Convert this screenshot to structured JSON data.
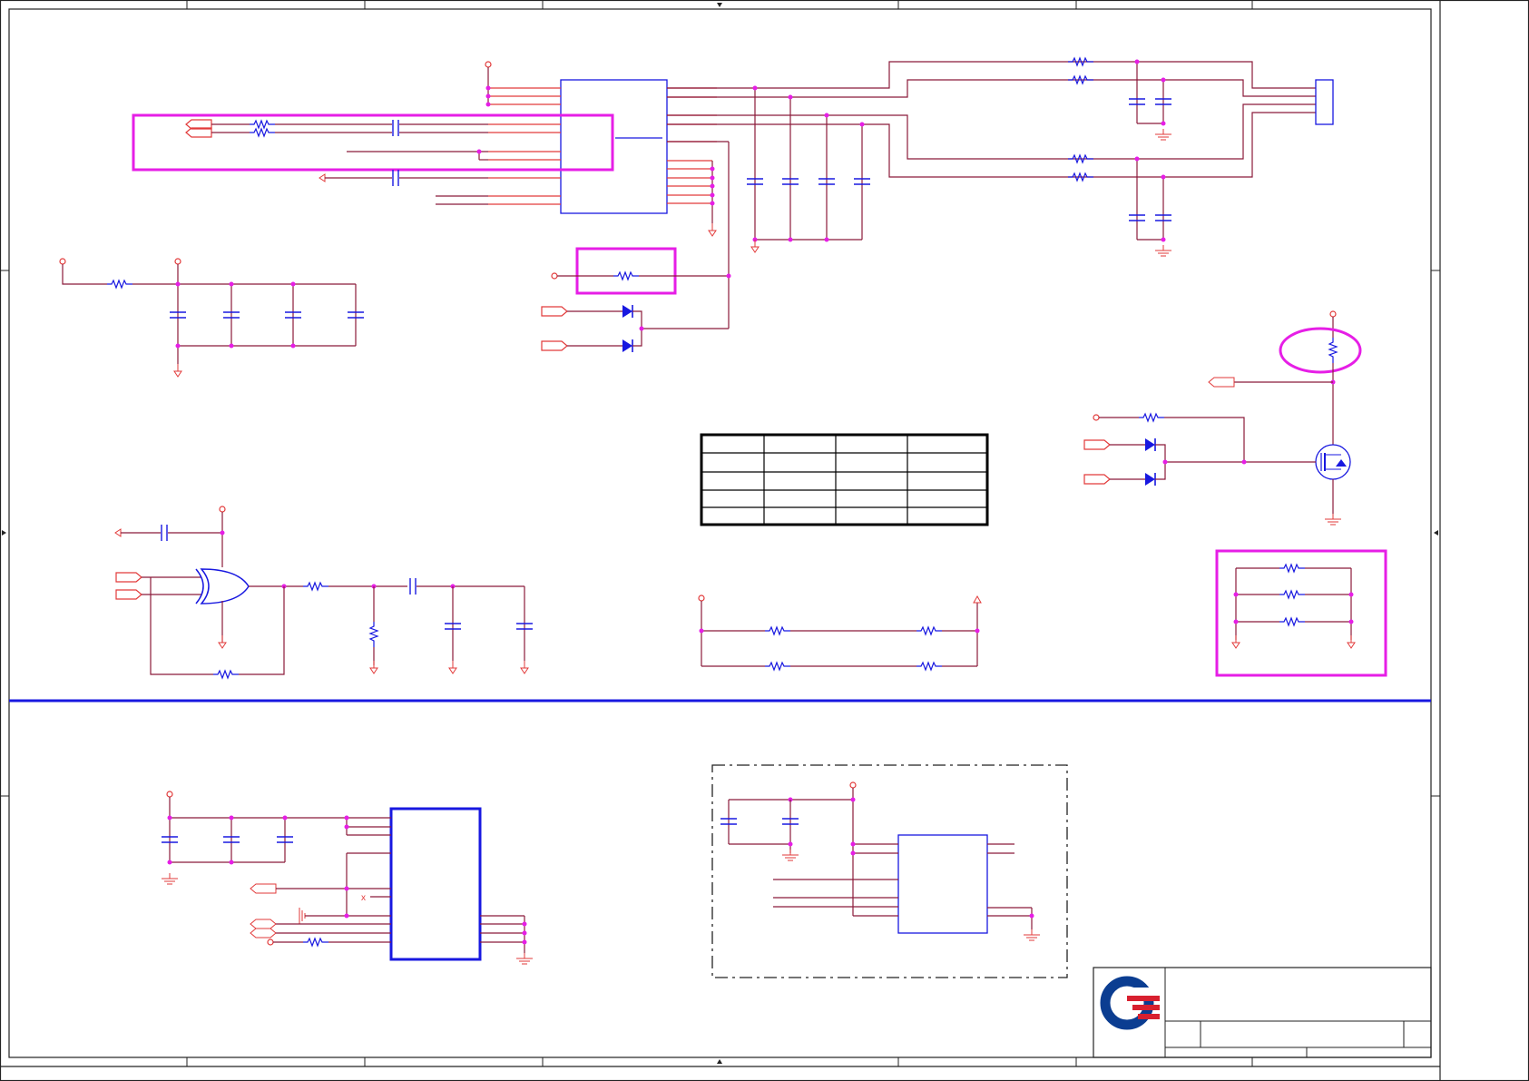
{
  "sheet": {
    "colors": {
      "wire": "#8b1a3a",
      "pin": "#e23a3a",
      "part": "#1818e0",
      "highlight": "#e61ee6",
      "logo_blue": "#0b3d91",
      "logo_red": "#d8202f"
    },
    "icons": [
      "resistor-icon",
      "capacitor-icon",
      "diode-icon",
      "xor-gate-icon",
      "mosfet-icon",
      "ground-icon",
      "power-rail-icon",
      "off-page-connector-icon",
      "company-logo-icon"
    ]
  }
}
